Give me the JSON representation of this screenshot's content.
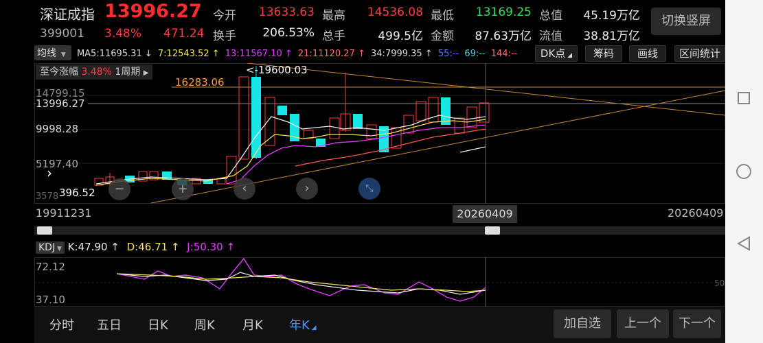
{
  "header": {
    "name": "深证成指",
    "price": "13996.27",
    "code": "399001",
    "change_pct": "3.48%",
    "change_abs": "471.24",
    "stats_row1": [
      {
        "label": "今开",
        "value": "13633.63",
        "color": "red"
      },
      {
        "label": "最高",
        "value": "14536.08",
        "color": "red"
      },
      {
        "label": "最低",
        "value": "13169.25",
        "color": "green"
      },
      {
        "label": "总值",
        "value": "45.19万亿",
        "color": "white"
      }
    ],
    "stats_row2": [
      {
        "label": "换手",
        "value": "206.53%",
        "color": "white"
      },
      {
        "label": "总手",
        "value": "499.5亿",
        "color": "white"
      },
      {
        "label": "金额",
        "value": "87.63万亿",
        "color": "white"
      },
      {
        "label": "流值",
        "value": "38.81万亿",
        "color": "white"
      }
    ],
    "switch_label": "切换竖屏"
  },
  "ma_legend": {
    "selector": "均线",
    "items": [
      {
        "text": "MA5:11695.31 ↓",
        "color": "#dddddd"
      },
      {
        "text": "7:12543.52 ↑",
        "color": "#f5e15a"
      },
      {
        "text": "13:11567.10 ↑",
        "color": "#e040fb"
      },
      {
        "text": "21:11120.27 ↑",
        "color": "#ff6e6e"
      },
      {
        "text": "34:7999.35 ↑",
        "color": "#dddddd"
      },
      {
        "text": "55:--",
        "color": "#5b7bff"
      },
      {
        "text": "69:--",
        "color": "#5ec8e6"
      },
      {
        "text": "144:--",
        "color": "#ff6e6e"
      }
    ]
  },
  "toolbar": {
    "dk": "DK点",
    "chips": "筹码",
    "draw": "画线",
    "range": "区间统计"
  },
  "kline": {
    "period_prefix": "至今涨幅",
    "period_pct": "3.48%",
    "period_label": "1周期",
    "max_label": "<-19600.03",
    "level_label": "16283.06",
    "y_labels": [
      "14799.15",
      "13996.27",
      "9998.28",
      "5197.40",
      "396.52",
      "3578"
    ],
    "date_left": "19911231",
    "date_cursor": "20260409",
    "date_right": "20260409"
  },
  "kdj": {
    "selector": "KDJ",
    "k": "K:47.90 ↑",
    "d": "D:46.71 ↑",
    "j": "J:50.30 ↑",
    "y_top": "72.12",
    "y_bottom": "37.10",
    "ref": "50"
  },
  "bottom_tabs": [
    "分时",
    "五日",
    "日K",
    "周K",
    "月K",
    "年K"
  ],
  "bottom_buttons": {
    "add": "加自选",
    "prev": "上一个",
    "next": "下一个"
  },
  "colors": {
    "up": "#ff3b3b",
    "down": "#19e6e6",
    "bg": "#000000"
  }
}
